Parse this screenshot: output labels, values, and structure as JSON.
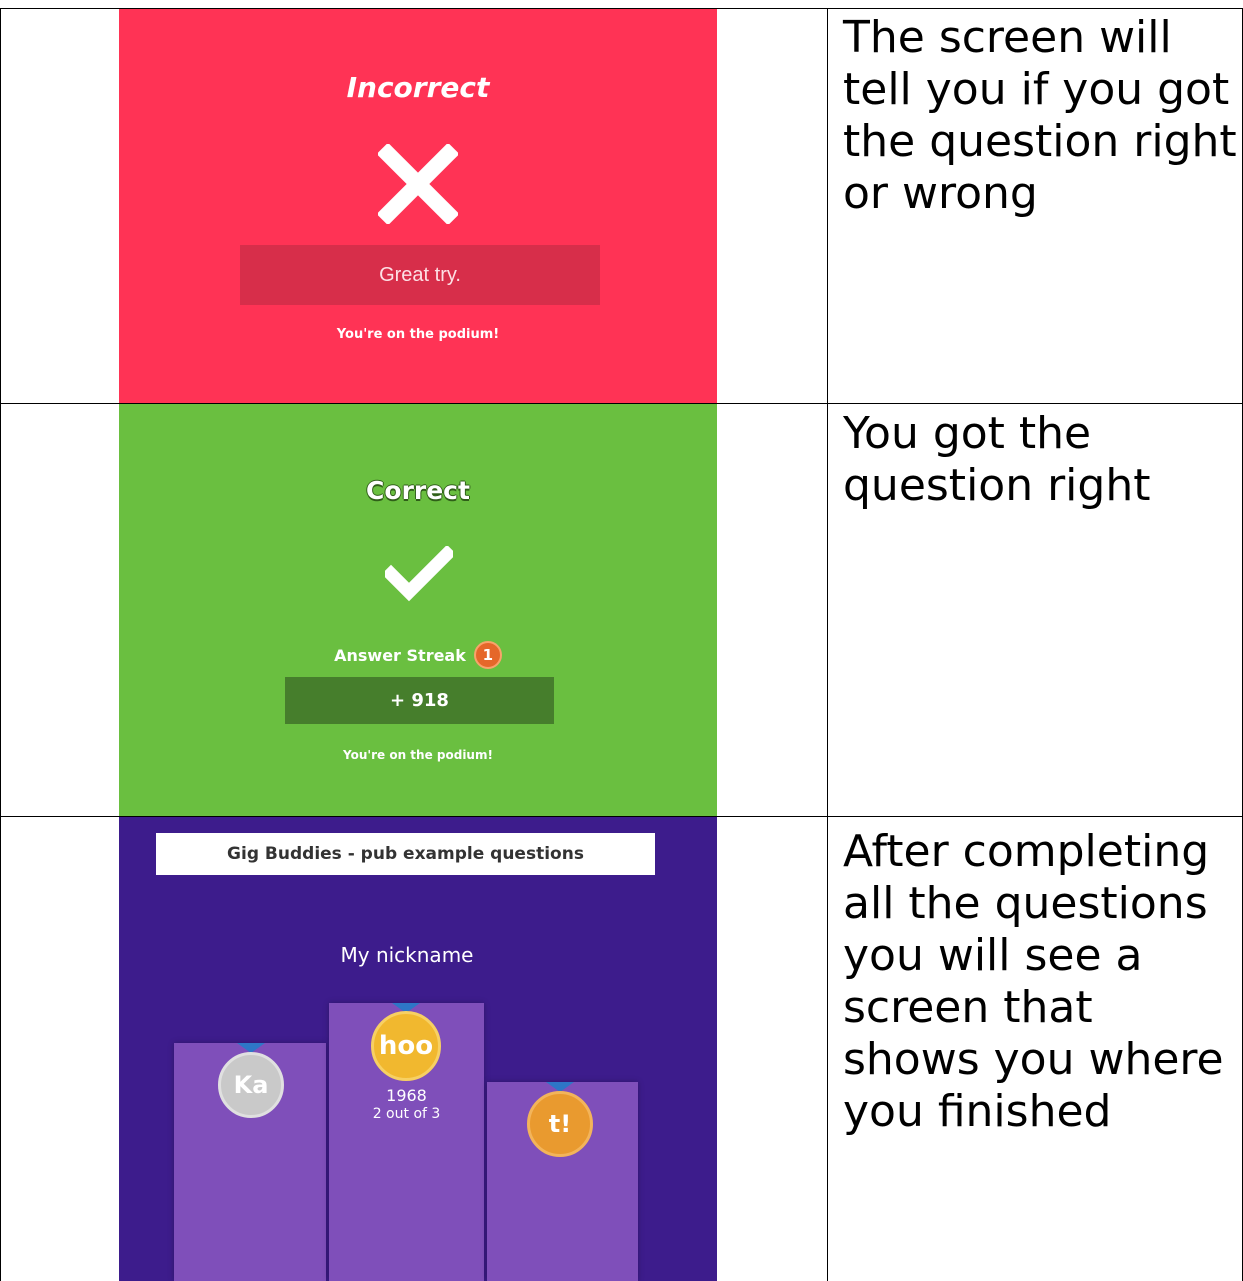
{
  "rows": [
    {
      "caption": "The screen will tell you if you got the question right or wrong",
      "screen": {
        "title": "Incorrect",
        "feedback": "Great try.",
        "footer": "You're on the podium!",
        "background": "#ff3355"
      }
    },
    {
      "caption": "You got the question right",
      "screen": {
        "title": "Correct",
        "streak_label": "Answer Streak",
        "streak_count": "1",
        "points": "+ 918",
        "footer": "You're on the podium!",
        "background": "#6abf40"
      }
    },
    {
      "caption": "After completing all the questions you will see a screen that shows you where you finished",
      "screen": {
        "quiz_title": "Gig Buddies - pub example questions",
        "player_name": "My nickname",
        "medals": [
          "Ka",
          "hoo",
          "t!"
        ],
        "score": "1968",
        "rank_text": "2 out of 3",
        "background": "#3d1c8c"
      }
    }
  ]
}
